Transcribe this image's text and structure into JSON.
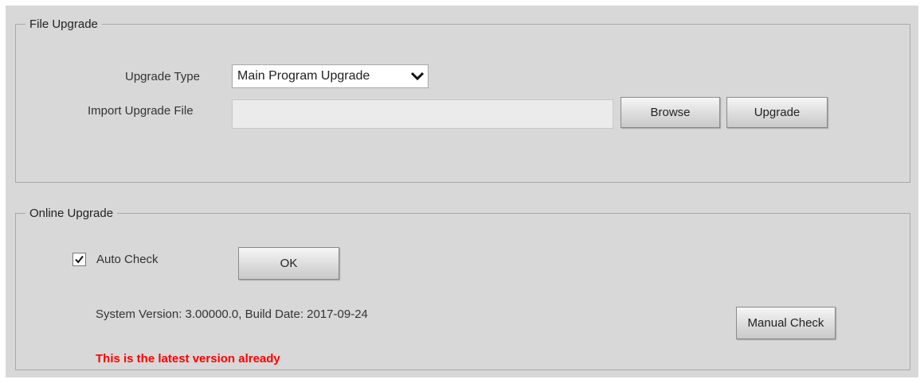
{
  "file_upgrade": {
    "legend": "File Upgrade",
    "upgrade_type_label": "Upgrade Type",
    "upgrade_type_value": "Main Program Upgrade",
    "import_file_label": "Import Upgrade File",
    "import_file_value": "",
    "browse_label": "Browse",
    "upgrade_label": "Upgrade"
  },
  "online_upgrade": {
    "legend": "Online Upgrade",
    "auto_check_label": "Auto Check",
    "auto_check_checked": true,
    "ok_label": "OK",
    "system_version_text": "System Version:  3.00000.0, Build Date: 2017-09-24",
    "manual_check_label": "Manual Check",
    "status_message": "This is the latest version already",
    "status_color": "#ff0000"
  },
  "icons": {
    "dropdown": "chevron-down-icon",
    "checkbox": "checkmark-icon"
  }
}
